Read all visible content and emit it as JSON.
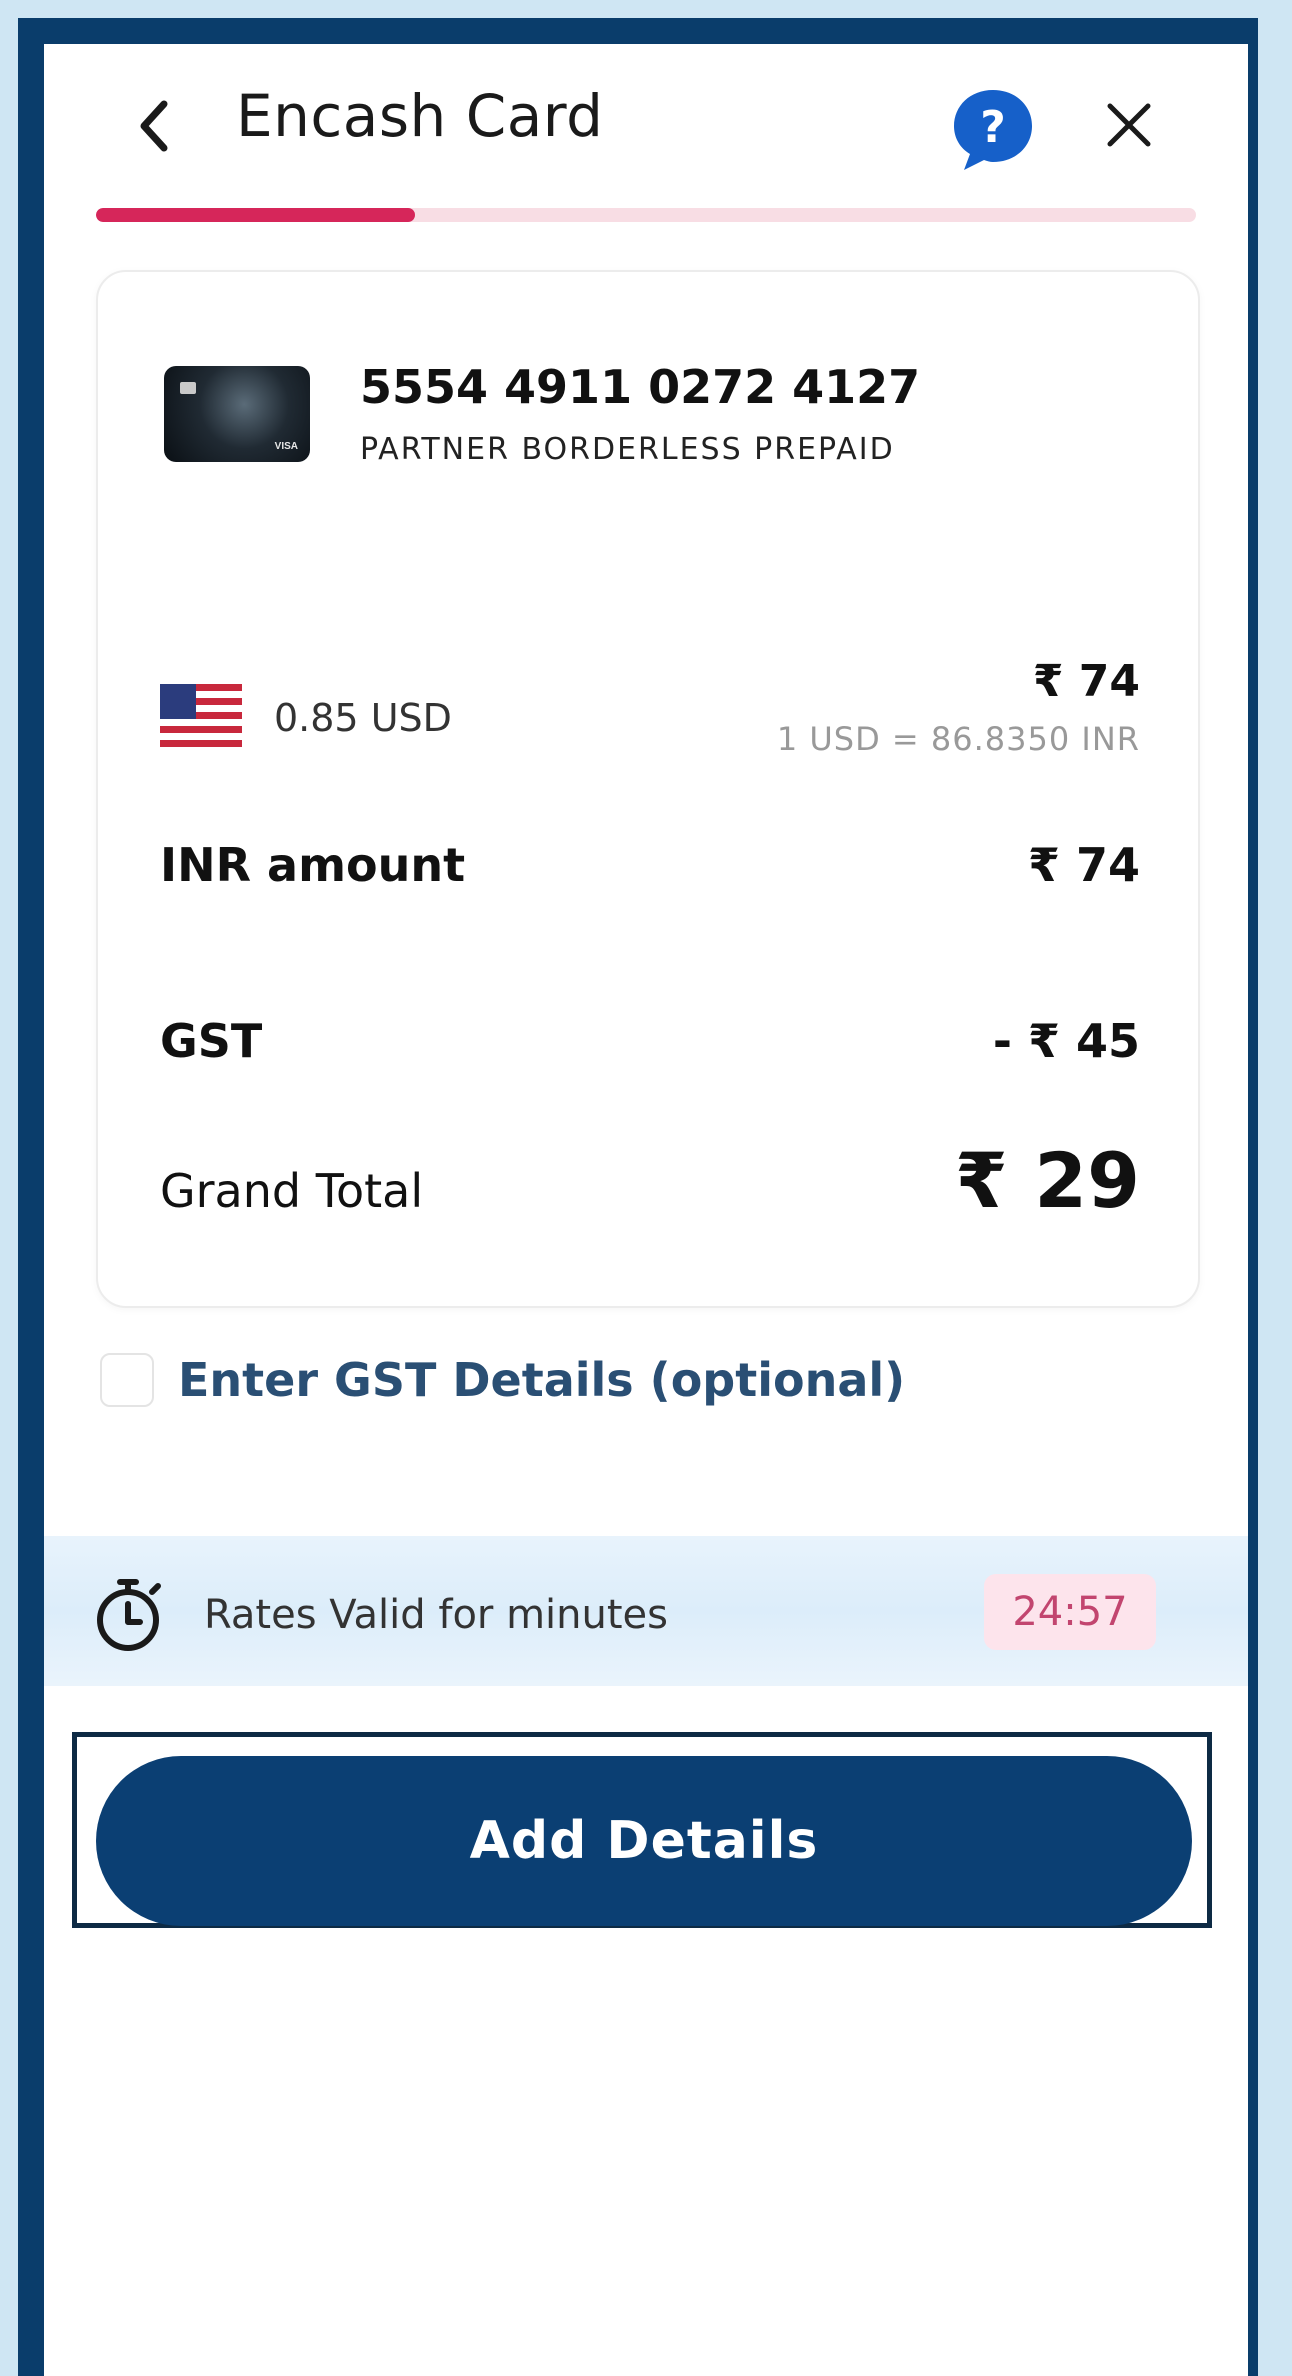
{
  "header": {
    "title": "Encash Card",
    "back_icon": "chevron-left-icon",
    "help_icon": "help-chat-icon",
    "close_icon": "close-icon",
    "progress_fraction": 0.29,
    "accent_color": "#d6265a"
  },
  "card": {
    "number": "5554 4911 0272 4127",
    "type": "PARTNER BORDERLESS PREPAID"
  },
  "conversion": {
    "flag_icon": "us-flag-icon",
    "usd_amount": "0.85 USD",
    "inr_amount": "₹ 74",
    "rate": "1 USD = 86.8350 INR"
  },
  "summary": {
    "inr_label": "INR amount",
    "inr_value": "₹ 74",
    "gst_label": "GST",
    "gst_value": "- ₹ 45",
    "total_label": "Grand Total",
    "total_value": "₹ 29"
  },
  "gst_option": {
    "label": "Enter GST Details (optional)",
    "checked": false
  },
  "timer": {
    "icon": "stopwatch-icon",
    "text": "Rates Valid for minutes",
    "value": "24:57"
  },
  "cta": {
    "label": "Add Details",
    "color": "#0b3f73"
  }
}
